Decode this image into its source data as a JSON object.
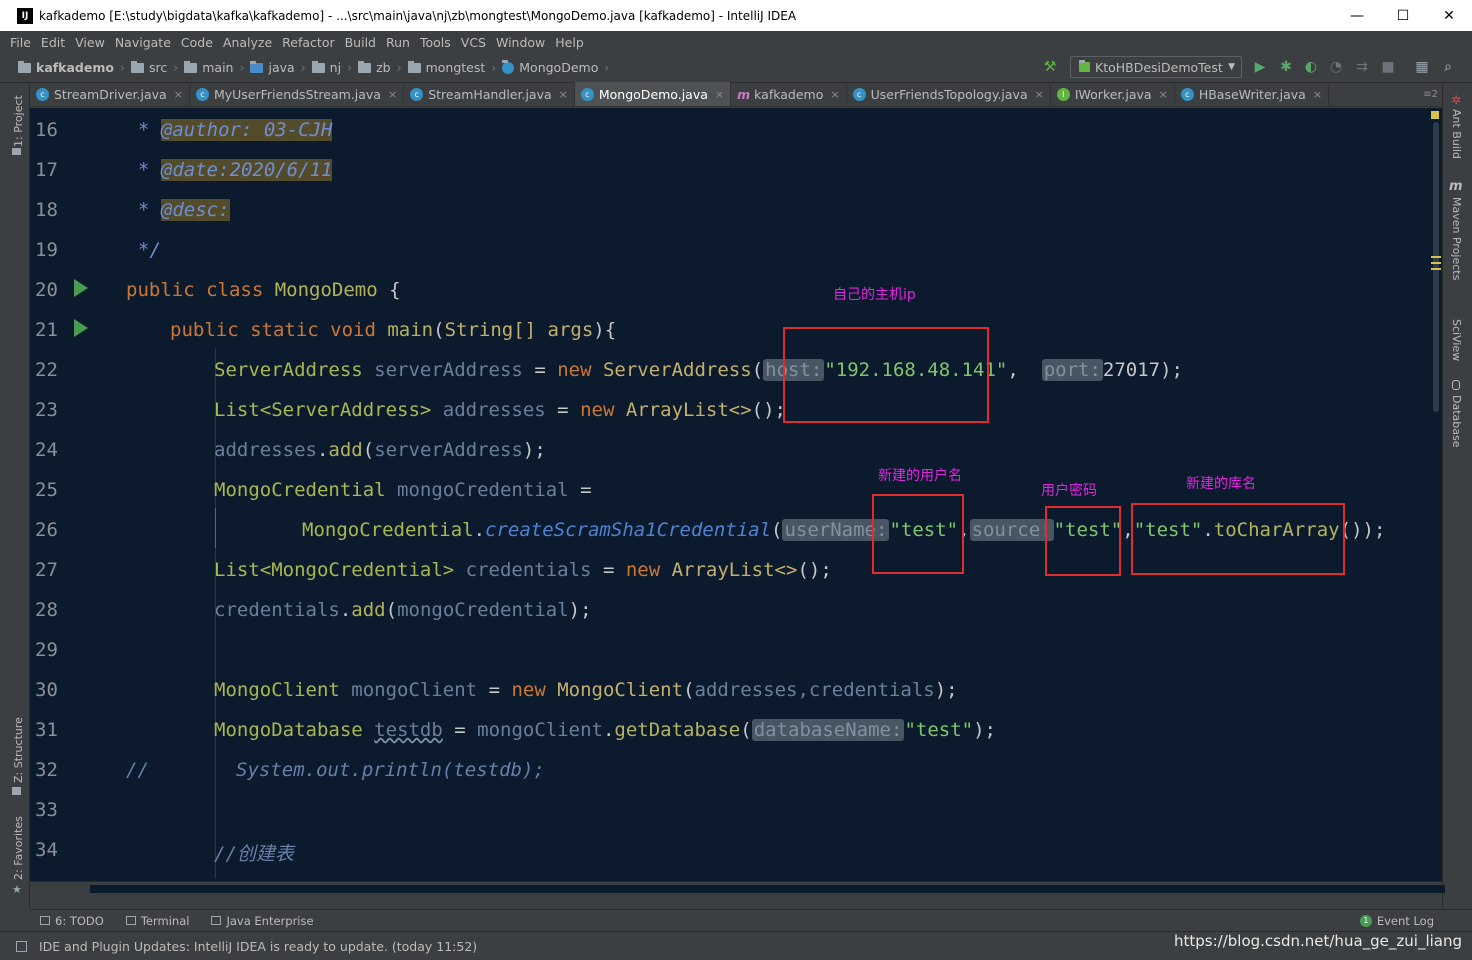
{
  "window": {
    "title": "kafkademo [E:\\study\\bigdata\\kafka\\kafkademo] - ...\\src\\main\\java\\nj\\zb\\mongtest\\MongoDemo.java [kafkademo] - IntelliJ IDEA",
    "app_icon": "IJ",
    "minimize": "—",
    "maximize": "☐",
    "close": "✕"
  },
  "menu": [
    "File",
    "Edit",
    "View",
    "Navigate",
    "Code",
    "Analyze",
    "Refactor",
    "Build",
    "Run",
    "Tools",
    "VCS",
    "Window",
    "Help"
  ],
  "breadcrumb": [
    "kafkademo",
    "src",
    "main",
    "java",
    "nj",
    "zb",
    "mongtest",
    "MongoDemo"
  ],
  "run_config": "KtoHBDesiDemoTest",
  "tabs": [
    {
      "label": "StreamDriver.java",
      "kind": "class"
    },
    {
      "label": "MyUserFriendsStream.java",
      "kind": "class"
    },
    {
      "label": "StreamHandler.java",
      "kind": "class"
    },
    {
      "label": "MongoDemo.java",
      "kind": "class",
      "active": true
    },
    {
      "label": "kafkademo",
      "kind": "maven"
    },
    {
      "label": "UserFriendsTopology.java",
      "kind": "class"
    },
    {
      "label": "IWorker.java",
      "kind": "interface"
    },
    {
      "label": "HBaseWriter.java",
      "kind": "class"
    }
  ],
  "tab_overflow": "≡2",
  "left_tools": {
    "project": "1: Project",
    "structure": "Z: Structure",
    "favorites": "2: Favorites"
  },
  "right_tools": {
    "ant": "Ant Build",
    "maven": "Maven Projects",
    "sciview": "SciView",
    "database": "Database"
  },
  "line_numbers": [
    "16",
    "17",
    "18",
    "19",
    "20",
    "21",
    "22",
    "23",
    "24",
    "25",
    "26",
    "27",
    "28",
    "29",
    "30",
    "31",
    "32",
    "33",
    "34"
  ],
  "code": {
    "l16_star": "* ",
    "l16_tag": "@author:",
    "l16_val": " 03-CJH",
    "l17_star": "* ",
    "l17_tag": "@date:2020/6/11",
    "l18_star": "* ",
    "l18_tag": "@desc:",
    "l19": "*/",
    "l20_kw": "public class ",
    "l20_name": "MongoDemo",
    "l20_rest": " {",
    "l21_kw": "public static void ",
    "l21_name": "main",
    "l21_p1": "(",
    "l21_type": "String[] args",
    "l21_rest": "){",
    "l22_type": "ServerAddress ",
    "l22_var": "serverAddress",
    "l22_eq": " = ",
    "l22_new": "new ",
    "l22_ctor": "ServerAddress",
    "l22_p": "(",
    "l22_hint1": "host:",
    "l22_str": "\"192.168.48.141\"",
    "l22_comma": ",  ",
    "l22_hint2": "port:",
    "l22_num": "27017",
    "l22_end": ");",
    "l23_type": "List<ServerAddress> ",
    "l23_var": "addresses",
    "l23_eq": " = ",
    "l23_new": "new ",
    "l23_ctor": "ArrayList<>",
    "l23_end": "();",
    "l24_var": "addresses",
    "l24_dot": ".",
    "l24_fn": "add",
    "l24_p": "(",
    "l24_arg": "serverAddress",
    "l24_end": ");",
    "l25_type": "MongoCredential ",
    "l25_var": "mongoCredential",
    "l25_eq": " =",
    "l26_cls": "MongoCredential",
    "l26_dot": ".",
    "l26_fn": "createScramSha1Credential",
    "l26_p": "(",
    "l26_hint1": "userName:",
    "l26_s1": "\"test\"",
    "l26_c1": ",",
    "l26_hint2": "source:",
    "l26_s2": "\"test\"",
    "l26_c2": ",",
    "l26_s3": "\"test\"",
    "l26_dot2": ".",
    "l26_fn2": "toCharArray",
    "l26_end": "());",
    "l27_type": "List<MongoCredential> ",
    "l27_var": "credentials",
    "l27_eq": " = ",
    "l27_new": "new ",
    "l27_ctor": "ArrayList<>",
    "l27_end": "();",
    "l28_var": "credentials",
    "l28_dot": ".",
    "l28_fn": "add",
    "l28_p": "(",
    "l28_arg": "mongoCredential",
    "l28_end": ");",
    "l30_type": "MongoClient ",
    "l30_var": "mongoClient",
    "l30_eq": " = ",
    "l30_new": "new ",
    "l30_ctor": "MongoClient",
    "l30_p": "(",
    "l30_args": "addresses,credentials",
    "l30_end": ");",
    "l31_type": "MongoDatabase ",
    "l31_var": "testdb",
    "l31_eq": " = ",
    "l31_obj": "mongoClient",
    "l31_dot": ".",
    "l31_fn": "getDatabase",
    "l31_p": "(",
    "l31_hint": "databaseName:",
    "l31_str": "\"test\"",
    "l31_end": ");",
    "l32_cm": "//",
    "l32_code": "System.out.println(testdb);",
    "l34_cm": "//创建表"
  },
  "annotations": {
    "ip": "自己的主机ip",
    "user": "新建的用户名",
    "pwd": "用户密码",
    "db": "新建的库名"
  },
  "bottom_tools": {
    "todo": "6: TODO",
    "terminal": "Terminal",
    "java_ee": "Java Enterprise",
    "event_log": "Event Log",
    "event_badge": "1"
  },
  "status_text": "IDE and Plugin Updates: IntelliJ IDEA is ready to update. (today 11:52)",
  "watermark": "https://blog.csdn.net/hua_ge_zui_liang",
  "colors": {
    "editor_bg": "#0b1a2d",
    "annotation": "#e026e0",
    "redbox": "#e02c2c"
  }
}
